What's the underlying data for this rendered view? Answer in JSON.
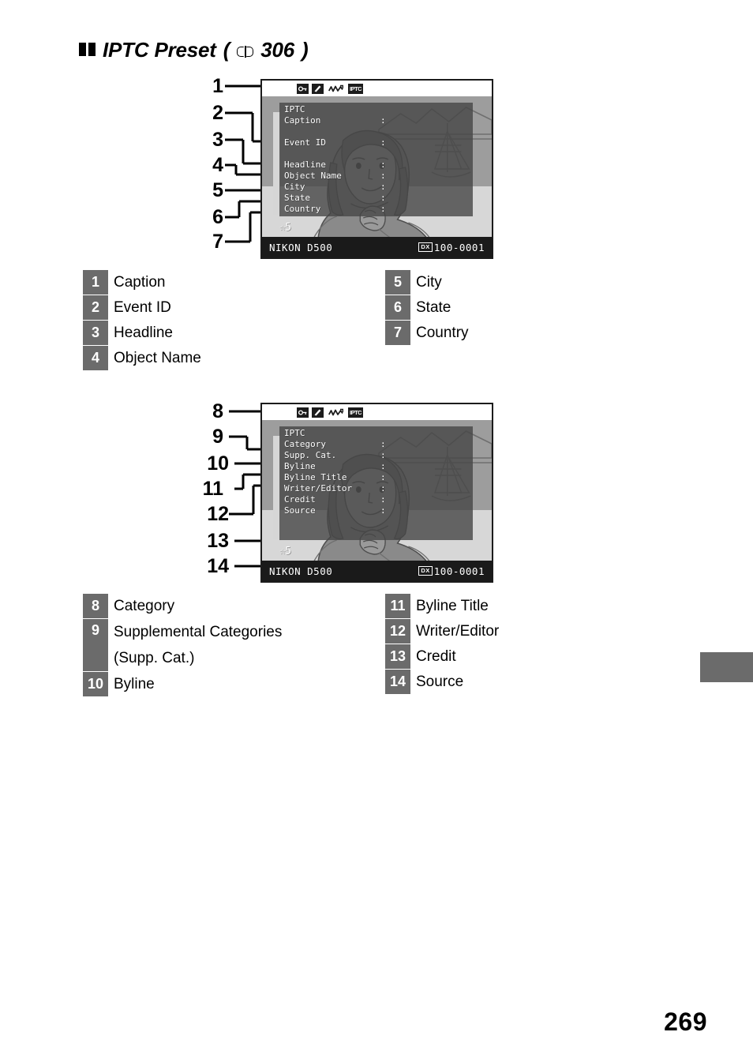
{
  "heading": {
    "title": "IPTC Preset",
    "ref_open": "(",
    "ref_icon": "book-icon",
    "ref_page": "306",
    "ref_close": ")"
  },
  "figure_one": {
    "lcd": {
      "icons": [
        "key-protect",
        "retouch",
        "histogram",
        "IPTC"
      ],
      "iptc_label": "IPTC",
      "rows": [
        {
          "label": "Caption",
          "colon": ":"
        },
        {
          "label": "Event ID",
          "colon": ":"
        },
        {
          "label": "Headline",
          "colon": ":"
        },
        {
          "label": "Object Name",
          "colon": ":"
        },
        {
          "label": "City",
          "colon": ":"
        },
        {
          "label": "State",
          "colon": ":"
        },
        {
          "label": "Country",
          "colon": ":"
        }
      ],
      "rating": "☆5",
      "camera": "NIKON D500",
      "format_badge": "DX",
      "frame_number": "100-0001"
    },
    "callouts": [
      "1",
      "2",
      "3",
      "4",
      "5",
      "6",
      "7"
    ]
  },
  "figure_two": {
    "lcd": {
      "icons": [
        "key-protect",
        "retouch",
        "histogram",
        "IPTC"
      ],
      "iptc_label": "IPTC",
      "rows": [
        {
          "label": "Category",
          "colon": ":"
        },
        {
          "label": "Supp. Cat.",
          "colon": ":"
        },
        {
          "label": "Byline",
          "colon": ":"
        },
        {
          "label": "Byline Title",
          "colon": ":"
        },
        {
          "label": "Writer/Editor",
          "colon": ":"
        },
        {
          "label": "Credit",
          "colon": ":"
        },
        {
          "label": "Source",
          "colon": ":"
        }
      ],
      "rating": "☆5",
      "camera": "NIKON D500",
      "format_badge": "DX",
      "frame_number": "100-0001"
    },
    "callouts": [
      "8",
      "9",
      "10",
      "11",
      "12",
      "13",
      "14"
    ]
  },
  "legend_one_left": [
    {
      "num": "1",
      "label": "Caption"
    },
    {
      "num": "2",
      "label": "Event ID"
    },
    {
      "num": "3",
      "label": "Headline"
    },
    {
      "num": "4",
      "label": "Object Name"
    }
  ],
  "legend_one_right": [
    {
      "num": "5",
      "label": "City"
    },
    {
      "num": "6",
      "label": "State"
    },
    {
      "num": "7",
      "label": "Country"
    }
  ],
  "legend_two_left": [
    {
      "num": "8",
      "label": "Category"
    },
    {
      "num": "9",
      "label": "Supplemental Categories\n (Supp. Cat.)"
    },
    {
      "num": "10",
      "label": "Byline"
    }
  ],
  "legend_two_right": [
    {
      "num": "11",
      "label": "Byline Title"
    },
    {
      "num": "12",
      "label": "Writer/Editor"
    },
    {
      "num": "13",
      "label": "Credit"
    },
    {
      "num": "14",
      "label": "Source"
    }
  ],
  "page_number": "269",
  "colors": {
    "badge_gray": "#6b6b6b",
    "lcd_bottom_bar": "#1a1a1a",
    "lcd_overlay": "rgba(70,70,70,0.80)"
  }
}
